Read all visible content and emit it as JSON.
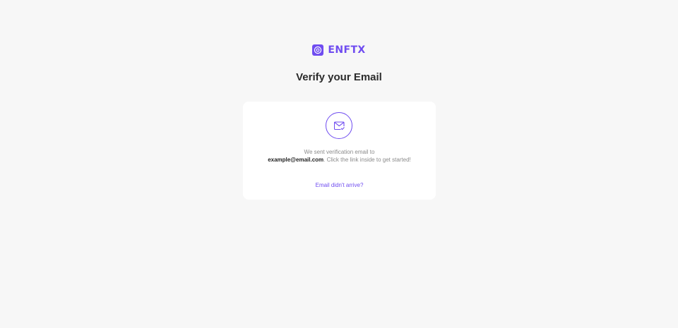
{
  "brand": {
    "name": "ENFTX",
    "logo_icon": "logo-icon",
    "accent_color": "#6f4cf0"
  },
  "page": {
    "title": "Verify your Email"
  },
  "card": {
    "icon": "mail-check-icon",
    "message_prefix": "We sent verification email to",
    "email": "example@email.com",
    "message_suffix": ". Click the link inside to get started!",
    "resend_label": "Email didn't arrive?"
  }
}
